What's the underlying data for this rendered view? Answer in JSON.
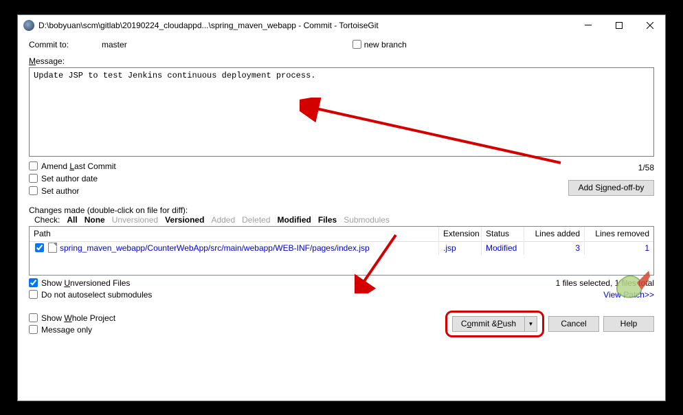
{
  "title": "D:\\bobyuan\\scm\\gitlab\\20190224_cloudappd...\\spring_maven_webapp - Commit - TortoiseGit",
  "commit_to_label": "Commit to:",
  "branch": "master",
  "new_branch": "new branch",
  "message_label": "Message:",
  "commit_message": "Update JSP to test Jenkins continuous deployment process.",
  "char_counter": "1/58",
  "amend_last": "Amend Last Commit",
  "set_author_date": "Set author date",
  "set_author": "Set author",
  "add_signed_off": "Add Signed-off-by",
  "changes_made": "Changes made (double-click on file for diff):",
  "check_label": "Check:",
  "filters": {
    "all": "All",
    "none": "None",
    "unversioned": "Unversioned",
    "versioned": "Versioned",
    "added": "Added",
    "deleted": "Deleted",
    "modified": "Modified",
    "files": "Files",
    "submodules": "Submodules"
  },
  "cols": {
    "path": "Path",
    "ext": "Extension",
    "status": "Status",
    "la": "Lines added",
    "lr": "Lines removed"
  },
  "file": {
    "path": "spring_maven_webapp/CounterWebApp/src/main/webapp/WEB-INF/pages/index.jsp",
    "ext": ".jsp",
    "status": "Modified",
    "la": "3",
    "lr": "1"
  },
  "selection_summary": "1 files selected, 1 files total",
  "show_unversioned": "Show Unversioned Files",
  "no_autoselect": "Do not autoselect submodules",
  "view_patch": "View Patch>>",
  "show_whole": "Show Whole Project",
  "message_only": "Message only",
  "commit_push": "Commit & Push",
  "cancel": "Cancel",
  "help": "Help"
}
